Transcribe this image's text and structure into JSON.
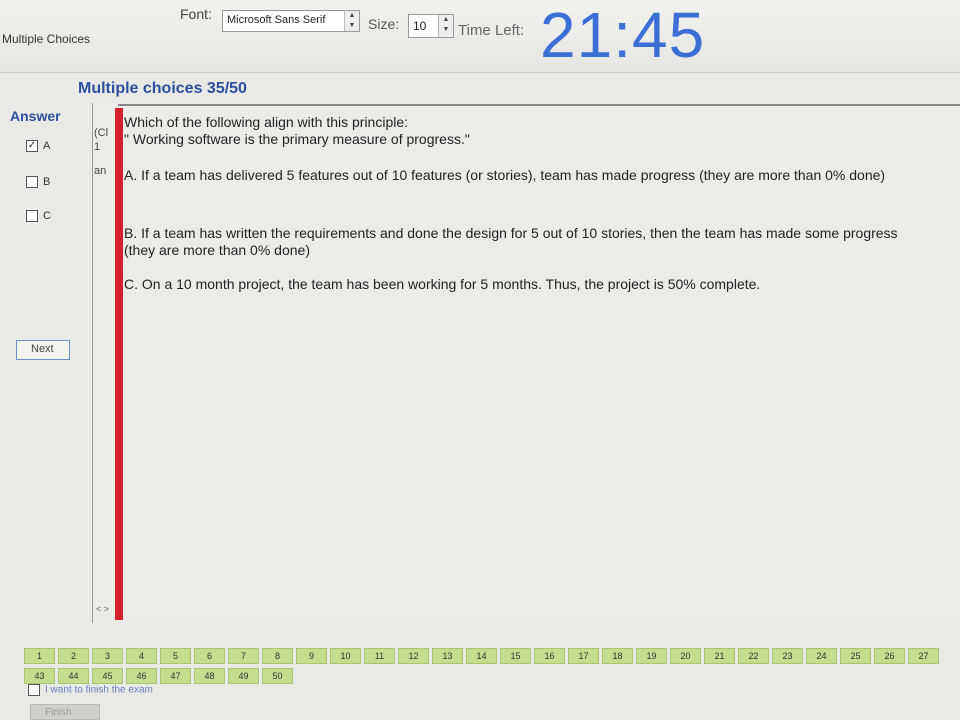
{
  "window": {
    "section_label": "Multiple Choices"
  },
  "toolbar": {
    "font_label": "Font:",
    "font_value": "Microsoft Sans Serif",
    "size_label": "Size:",
    "size_value": "10",
    "time_left_label": "Time Left:",
    "timer": "21:45"
  },
  "question": {
    "title": "Multiple choices 35/50",
    "narrow_col": [
      "(Cl",
      "1",
      "an"
    ],
    "text_line1": "Which of the following align with this principle:",
    "text_line2": "\" Working software is the primary measure of progress.\"",
    "options": [
      {
        "text": "A.  If a team has delivered 5 features out of 10 features (or stories), team has made progress (they are more than 0% done)"
      },
      {
        "text": "B.  If a team has written the requirements and done the design for 5 out of 10 stories, then the team has made some progress (they are more than 0% done)"
      },
      {
        "text": "C.  On a 10 month project, the team has been working for 5 months. Thus, the project is 50% complete."
      }
    ]
  },
  "answer": {
    "label": "Answer",
    "choices": [
      {
        "label": "A",
        "checked": true
      },
      {
        "label": "B",
        "checked": false
      },
      {
        "label": "C",
        "checked": false
      }
    ],
    "next_label": "Next"
  },
  "navigator": {
    "row1": [
      "1",
      "2",
      "3",
      "4",
      "5",
      "6",
      "7",
      "8",
      "9",
      "10",
      "11",
      "12",
      "13",
      "14",
      "15",
      "16",
      "17",
      "18",
      "19",
      "20",
      "21",
      "22",
      "23",
      "24",
      "25",
      "26",
      "27"
    ],
    "row2": [
      "43",
      "44",
      "45",
      "46",
      "47",
      "48",
      "49",
      "50"
    ],
    "finish_check_label": "I want to finish the exam",
    "finish_label": "Finish"
  }
}
